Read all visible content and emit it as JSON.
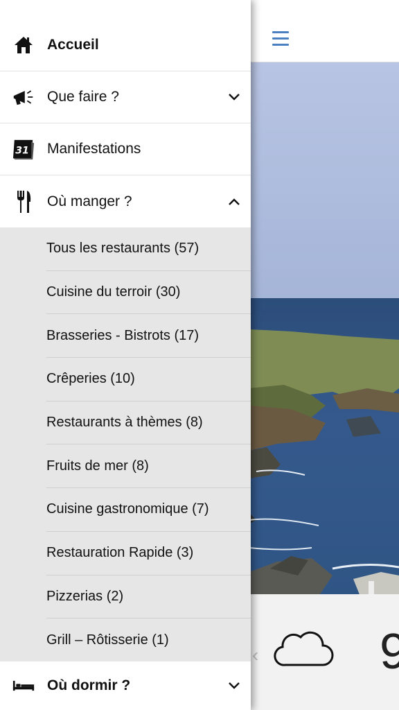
{
  "drawer": {
    "items": [
      {
        "label": "Accueil",
        "icon": "home-icon"
      },
      {
        "label": "Que faire ?",
        "icon": "megaphone-icon"
      },
      {
        "label": "Manifestations",
        "icon": "calendar-icon",
        "badge": "31"
      },
      {
        "label": "Où manger ?",
        "icon": "cutlery-icon"
      }
    ],
    "submenu": [
      "Tous les restaurants (57)",
      "Cuisine du terroir (30)",
      "Brasseries - Bistrots (17)",
      "Crêperies (10)",
      "Restaurants à thèmes (8)",
      "Fruits de mer (8)",
      "Cuisine gastronomique (7)",
      "Restauration Rapide (3)",
      "Pizzerias (2)",
      "Grill – Rôtisserie (1)"
    ],
    "bottom": {
      "label": "Où dormir ?",
      "icon": "bed-icon"
    }
  },
  "background_app": {
    "menu_icon": "hamburger-icon",
    "weather_icon": "cloud-icon",
    "temperature_partial": "9"
  },
  "colors": {
    "accent": "#4a7fc1",
    "submenu_bg": "#e6e6e6"
  }
}
